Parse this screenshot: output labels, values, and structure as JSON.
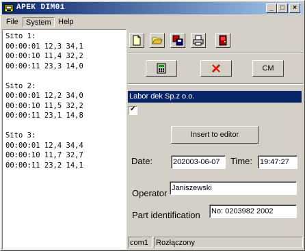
{
  "window": {
    "title": "APEK  DIM01"
  },
  "window_controls": {
    "minimize": "_",
    "maximize": "□",
    "close": "×"
  },
  "menu": {
    "file": "File",
    "system": "System",
    "help": "Help"
  },
  "log": {
    "text": "Sito 1:\n00:00:01 12,3 34,1\n00:00:10 11,4 32,2\n00:00:11 23,3 14,0\n\nSito 2:\n00:00:01 12,2 34,0\n00:00:10 11,5 32,2\n00:00:11 23,1 14,8\n\nSito 3:\n00:00:01 12,4 34,4\n00:00:10 11,7 32,7\n00:00:11 23,2 14,1"
  },
  "toolbar": {
    "cm_label": "CM"
  },
  "company": {
    "name": "Labor dek Sp.z o.o."
  },
  "checkbox": {
    "checked": "✔"
  },
  "form": {
    "insert_label": "Insert to editor",
    "date_label": "Date:",
    "date_value": "202003-06-07",
    "time_label": "Time:",
    "time_value": "19:47:27",
    "operator_label": "Operator",
    "operator_value": "Janiszewski",
    "part_label": "Part identification",
    "part_value": "No:  0203982 2002"
  },
  "status": {
    "port": "com1",
    "state": "Rozłączony"
  },
  "icons": [
    "app-icon",
    "new-file-icon",
    "open-folder-icon",
    "save-icon",
    "print-icon",
    "exit-door-icon",
    "calculator-icon",
    "disconnect-icon"
  ],
  "colors": {
    "titlebar": "#0a246a",
    "selection": "#0a246a",
    "face": "#d4d0c8"
  }
}
